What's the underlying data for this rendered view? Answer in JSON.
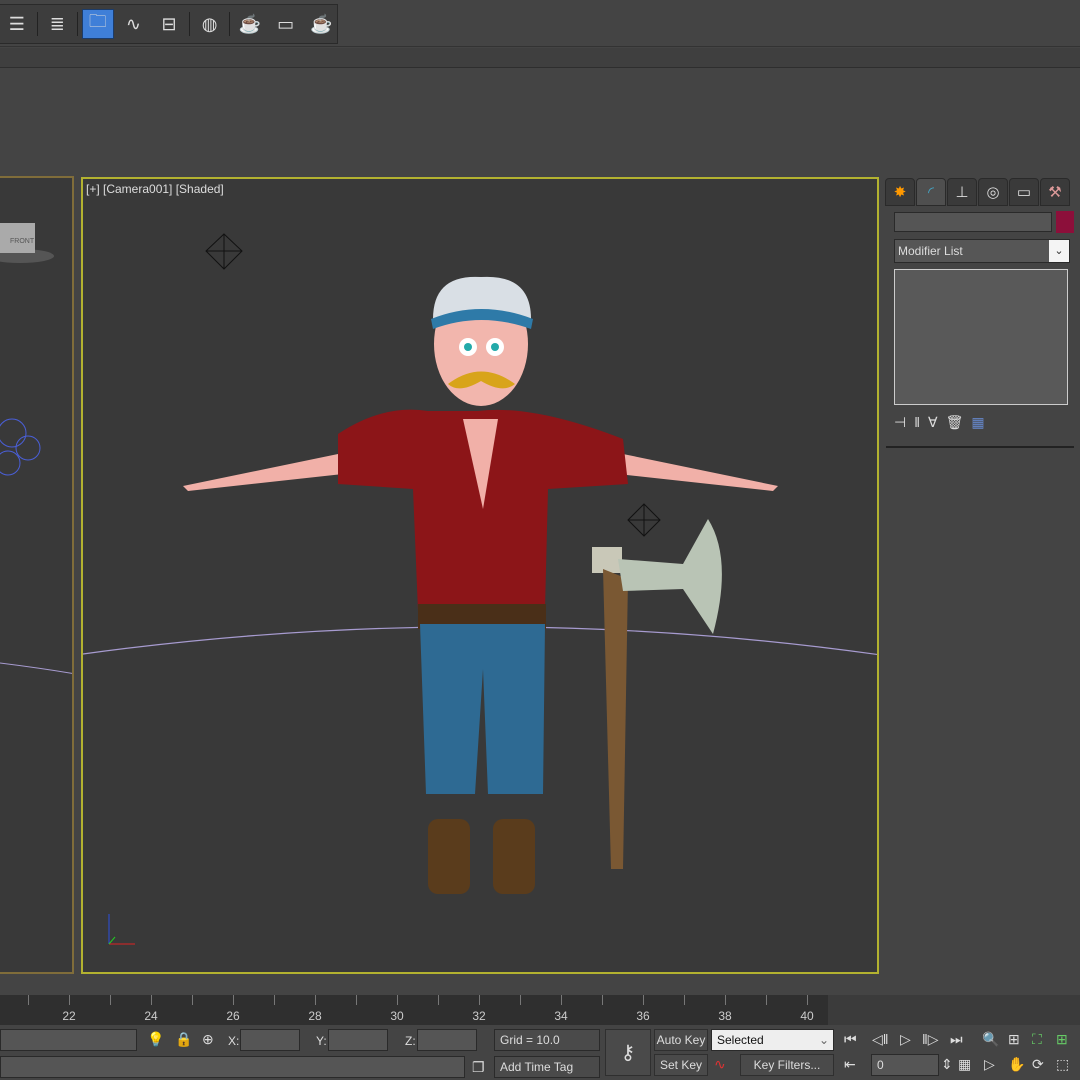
{
  "toolbar": {
    "icons": [
      "layer-manager-icon",
      "scene-explorer-icon",
      "folder-light-icon",
      "curve-editor-icon",
      "schematic-view-icon",
      "material-editor-icon",
      "render-setup-icon",
      "rendered-frame-icon",
      "render-teapot-icon"
    ]
  },
  "viewport": {
    "label": "[+] [Camera001] [Shaded]",
    "left_label": "FRONT"
  },
  "command_panel": {
    "tabs": [
      "create",
      "modify",
      "hierarchy",
      "motion",
      "display",
      "utilities"
    ],
    "active_tab": "modify",
    "modifier_list": "Modifier List",
    "color": "#8c0f3a"
  },
  "timeline": {
    "labels": [
      "22",
      "24",
      "26",
      "28",
      "30",
      "32",
      "34",
      "36",
      "38",
      "40"
    ]
  },
  "status": {
    "x_label": "X:",
    "y_label": "Y:",
    "z_label": "Z:",
    "grid": "Grid = 10.0",
    "add_time_tag": "Add Time Tag",
    "auto_key": "Auto Key",
    "set_key": "Set Key",
    "selected": "Selected",
    "key_filters": "Key Filters...",
    "frame": "0"
  }
}
